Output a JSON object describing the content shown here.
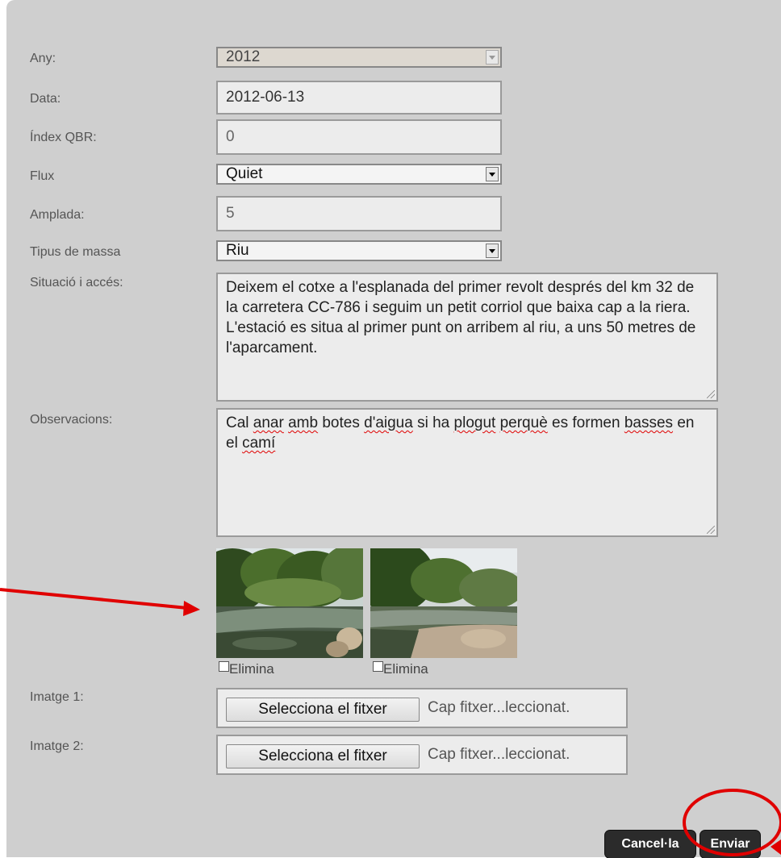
{
  "form": {
    "any": {
      "label": "Any:",
      "value": "2012"
    },
    "data": {
      "label": "Data:",
      "value": "2012-06-13"
    },
    "qbr": {
      "label": "Índex QBR:",
      "value": "0"
    },
    "flux": {
      "label": "Flux",
      "value": "Quiet"
    },
    "amplada": {
      "label": "Amplada:",
      "value": "5"
    },
    "tipus": {
      "label": "Tipus de massa",
      "value": "Riu"
    },
    "situacio": {
      "label": "Situació i accés:",
      "value": "Deixem el cotxe a l'esplanada del primer revolt després del km 32 de la carretera CC-786 i seguim un petit corriol que baixa cap a la riera. L'estació es situa al primer punt on arribem al riu, a uns 50 metres de l'aparcament."
    },
    "observacions": {
      "label": "Observacions:",
      "words": [
        "Cal",
        "anar",
        "amb",
        "botes",
        "d'aigua",
        "si",
        "ha",
        "plogut",
        "perquè",
        "es",
        "formen",
        "basses",
        "en",
        "el",
        "camí"
      ]
    },
    "photos": [
      {
        "delete_label": "Elimina"
      },
      {
        "delete_label": "Elimina"
      }
    ],
    "image1": {
      "label": "Imatge 1:",
      "button": "Selecciona el fitxer",
      "status": "Cap fitxer...leccionat."
    },
    "image2": {
      "label": "Imatge 2:",
      "button": "Selecciona el fitxer",
      "status": "Cap fitxer...leccionat."
    },
    "cancel_label": "Cancel·la",
    "submit_label": "Enviar"
  },
  "colors": {
    "panel": "#cfcfcf",
    "annotation": "#e00000",
    "button": "#2b2b2b"
  },
  "icons": [
    "dropdown-arrow-icon",
    "resize-grip-icon",
    "annotation-arrow-icon",
    "highlight-circle-icon"
  ]
}
